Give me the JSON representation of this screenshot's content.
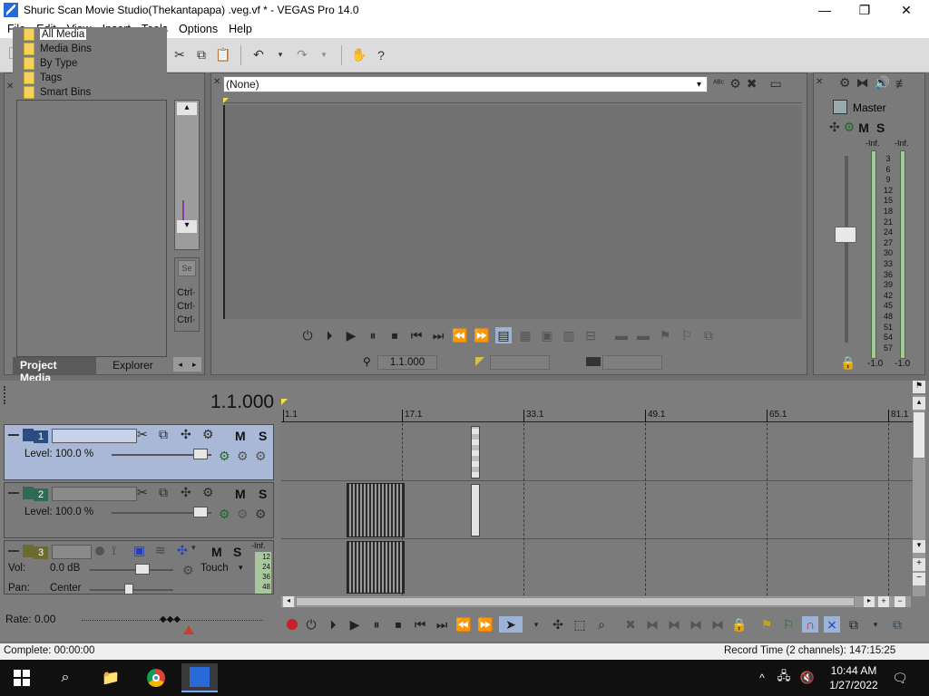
{
  "window": {
    "title": "Shuric Scan Movie Studio(Thekantapapa) .veg.vf * - VEGAS Pro 14.0",
    "controls": [
      "—",
      "❐",
      "✕"
    ]
  },
  "menu": [
    "File",
    "Edit",
    "View",
    "Insert",
    "Tools",
    "Options",
    "Help"
  ],
  "project_media": {
    "tree": [
      {
        "label": "All Media",
        "selected": true,
        "expandable": false
      },
      {
        "label": "Media Bins",
        "selected": false,
        "expandable": false
      },
      {
        "label": "By Type",
        "selected": false,
        "expandable": true
      },
      {
        "label": "Tags",
        "selected": false,
        "expandable": false
      },
      {
        "label": "Smart Bins",
        "selected": false,
        "expandable": false
      }
    ],
    "tabs": [
      "Project Media",
      "Explorer"
    ],
    "side_labels": [
      "Ctrl·",
      "Ctrl·",
      "Ctrl·"
    ],
    "side_button": "Se"
  },
  "preview": {
    "preset": "(None)",
    "position": "1.1.000"
  },
  "master": {
    "label": "Master",
    "inf_left": "-Inf.",
    "inf_right": "-Inf.",
    "scale": [
      "3",
      "6",
      "9",
      "12",
      "15",
      "18",
      "21",
      "24",
      "27",
      "30",
      "33",
      "36",
      "39",
      "42",
      "45",
      "48",
      "51",
      "54",
      "57"
    ],
    "peak_left": "-1.0",
    "peak_right": "-1.0",
    "m": "M",
    "s": "S"
  },
  "timeline": {
    "cursor": "1.1.000",
    "ruler": [
      "1.1",
      "17.1",
      "33.1",
      "49.1",
      "65.1",
      "81.1"
    ],
    "tracks": [
      {
        "num": "1",
        "level": "Level: 100.0 %",
        "m": "M",
        "s": "S",
        "type": "video",
        "selected": true
      },
      {
        "num": "2",
        "level": "Level: 100.0 %",
        "m": "M",
        "s": "S",
        "type": "video",
        "selected": false
      }
    ],
    "audio_track": {
      "num": "3",
      "vol_label": "Vol:",
      "vol": "0.0 dB",
      "pan_label": "Pan:",
      "pan": "Center",
      "mode": "Touch",
      "inf": "-Inf.",
      "meter": [
        "12",
        "24",
        "36",
        "48"
      ],
      "m": "M",
      "s": "S"
    },
    "rate": "Rate: 0.00"
  },
  "status": {
    "left": "Complete: 00:00:00",
    "right": "Record Time (2 channels): 147:15:25"
  },
  "taskbar": {
    "time": "10:44 AM",
    "date": "1/27/2022"
  }
}
